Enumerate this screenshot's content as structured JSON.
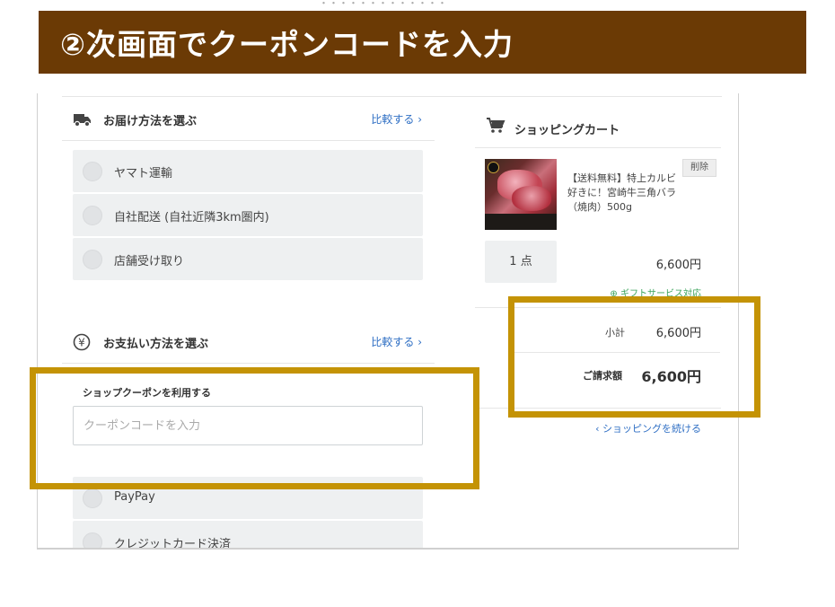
{
  "banner": {
    "title": "②次画面でクーポンコードを入力",
    "color": "#6b3a05"
  },
  "delivery": {
    "icon": "truck-icon",
    "title": "お届け方法を選ぶ",
    "compare": "比較する",
    "options": [
      "ヤマト運輸",
      "自社配送 (自社近隣3km圏内)",
      "店舗受け取り"
    ]
  },
  "payment": {
    "icon": "yen-icon",
    "title": "お支払い方法を選ぶ",
    "compare": "比較する",
    "coupon_label": "ショップクーポンを利用する",
    "coupon_placeholder": "クーポンコードを入力",
    "options": [
      "PayPay",
      "クレジットカード決済"
    ]
  },
  "cart": {
    "icon": "cart-icon",
    "title": "ショッピングカート",
    "item": {
      "name": "【送料無料】特上カルビ好きに！宮崎牛三角バラ（焼肉）500g",
      "delete": "削除",
      "quantity": "1 点",
      "price": "6,600円",
      "gift": "ギフトサービス対応"
    },
    "subtotal_label": "小計",
    "subtotal": "6,600円",
    "total_label": "ご請求額",
    "total": "6,600円",
    "continue": "ショッピングを続ける"
  },
  "colors": {
    "highlight": "#c49305",
    "link": "#2f6fc4",
    "gift": "#3aa35a"
  }
}
